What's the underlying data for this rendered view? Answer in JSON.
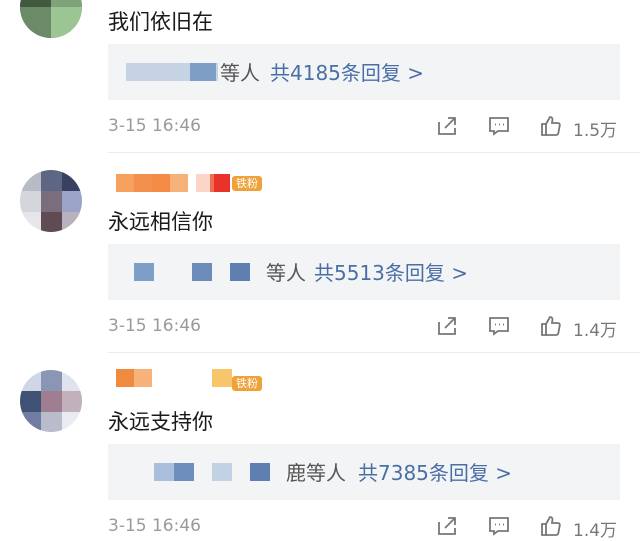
{
  "comments": [
    {
      "text": "我们依旧在",
      "reply_names_suffix": "等人",
      "reply_link": "共4185条回复 >",
      "time": "3-15 16:46",
      "likes": "1.5万"
    },
    {
      "badge": "铁粉",
      "text": "永远相信你",
      "reply_names_suffix": "等人",
      "reply_link": "共5513条回复 >",
      "time": "3-15 16:46",
      "likes": "1.4万"
    },
    {
      "badge": "铁粉",
      "text": "永远支持你",
      "reply_names_suffix": "鹿等人",
      "reply_link": "共7385条回复 >",
      "time": "3-15 16:46",
      "likes": "1.4万"
    }
  ],
  "icons": {
    "share": "share-icon",
    "comment": "comment-icon",
    "like": "thumbs-up-icon"
  },
  "colors": {
    "link": "#4a6fa5",
    "badge": "#f0a23a",
    "reply_bg": "#f3f4f6",
    "meta": "#9a9a9a"
  }
}
